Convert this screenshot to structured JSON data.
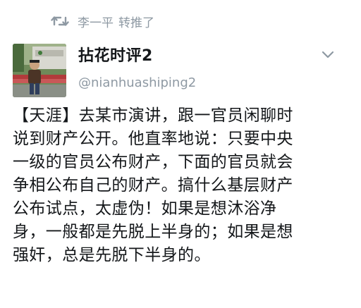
{
  "retweet": {
    "icon": "retweet-icon",
    "user": "李一平",
    "action": "转推了"
  },
  "author": {
    "display_name": "拈花时评2",
    "handle": "@nianhuashiping2",
    "avatar_icon": "avatar-photo"
  },
  "menu_icon": "chevron-down-icon",
  "tweet": {
    "lines": [
      "【天涯】去某市演讲，跟一官员闲聊时",
      "说到财产公开。他直率地说：只要中央",
      "一级的官员公布财产，下面的官员就会",
      "争相公布自己的财产。搞什么基层财产",
      "公布试点，太虚伪！如果是想沐浴净",
      "身，一般都是先脱上半身的；如果是想",
      "强奸，总是先脱下半身的。"
    ]
  },
  "colors": {
    "muted": "#8e99a3",
    "text": "#14171a",
    "background": "#ffffff"
  }
}
